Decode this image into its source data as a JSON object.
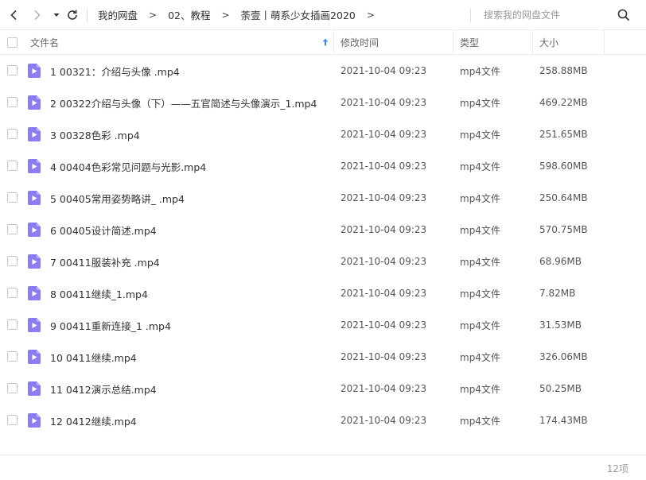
{
  "nav": {
    "back_icon": "chevron-left-icon",
    "forward_icon": "chevron-right-icon",
    "dropdown_icon": "caret-down-icon",
    "refresh_icon": "refresh-icon"
  },
  "breadcrumb": {
    "items": [
      "我的网盘",
      "02、教程",
      "荼壹丨萌系少女插画2020"
    ],
    "separator": ">"
  },
  "search": {
    "placeholder": "搜索我的网盘文件",
    "icon": "search-icon"
  },
  "table": {
    "headers": {
      "name": "文件名",
      "time": "修改时间",
      "type": "类型",
      "size": "大小"
    },
    "sort_icon": "sort-up-arrow-icon",
    "file_icon_color": "#8b7cf6",
    "rows": [
      {
        "name": "1 00321：介绍与头像 .mp4",
        "time": "2021-10-04 09:23",
        "type": "mp4文件",
        "size": "258.88MB"
      },
      {
        "name": "2 00322介绍与头像（下）——五官简述与头像演示_1.mp4",
        "time": "2021-10-04 09:23",
        "type": "mp4文件",
        "size": "469.22MB"
      },
      {
        "name": "3 00328色彩 .mp4",
        "time": "2021-10-04 09:23",
        "type": "mp4文件",
        "size": "251.65MB"
      },
      {
        "name": "4 00404色彩常见问题与光影.mp4",
        "time": "2021-10-04 09:23",
        "type": "mp4文件",
        "size": "598.60MB"
      },
      {
        "name": "5 00405常用姿势略讲_ .mp4",
        "time": "2021-10-04 09:23",
        "type": "mp4文件",
        "size": "250.64MB"
      },
      {
        "name": "6 00405设计简述.mp4",
        "time": "2021-10-04 09:23",
        "type": "mp4文件",
        "size": "570.75MB"
      },
      {
        "name": "7 00411服装补充 .mp4",
        "time": "2021-10-04 09:23",
        "type": "mp4文件",
        "size": "68.96MB"
      },
      {
        "name": "8 00411继续_1.mp4",
        "time": "2021-10-04 09:23",
        "type": "mp4文件",
        "size": "7.82MB"
      },
      {
        "name": "9 00411重新连接_1 .mp4",
        "time": "2021-10-04 09:23",
        "type": "mp4文件",
        "size": "31.53MB"
      },
      {
        "name": "10 0411继续.mp4",
        "time": "2021-10-04 09:23",
        "type": "mp4文件",
        "size": "326.06MB"
      },
      {
        "name": "11 0412演示总结.mp4",
        "time": "2021-10-04 09:23",
        "type": "mp4文件",
        "size": "50.25MB"
      },
      {
        "name": "12 0412继续.mp4",
        "time": "2021-10-04 09:23",
        "type": "mp4文件",
        "size": "174.43MB"
      }
    ]
  },
  "footer": {
    "count": "12项"
  }
}
